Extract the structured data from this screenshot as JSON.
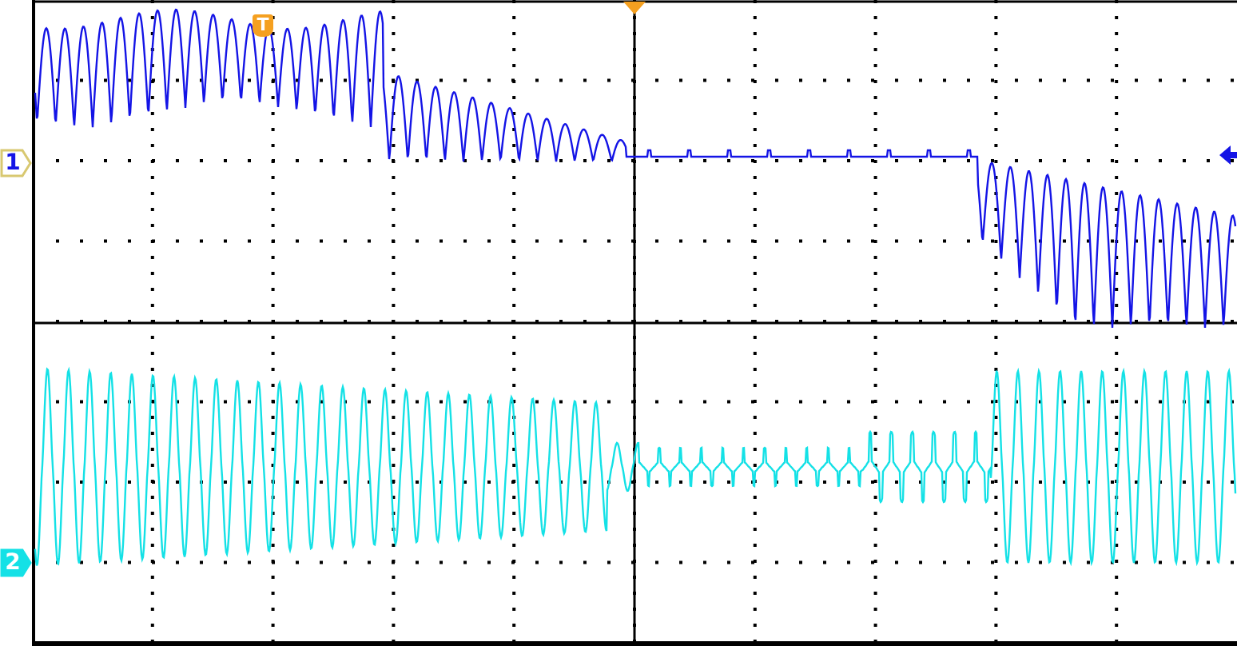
{
  "channels": [
    {
      "label": "1",
      "color": "#1414e6",
      "selected": true
    },
    {
      "label": "2",
      "color": "#14e1e6",
      "selected": false
    }
  ],
  "trigger": {
    "label": "T"
  }
}
